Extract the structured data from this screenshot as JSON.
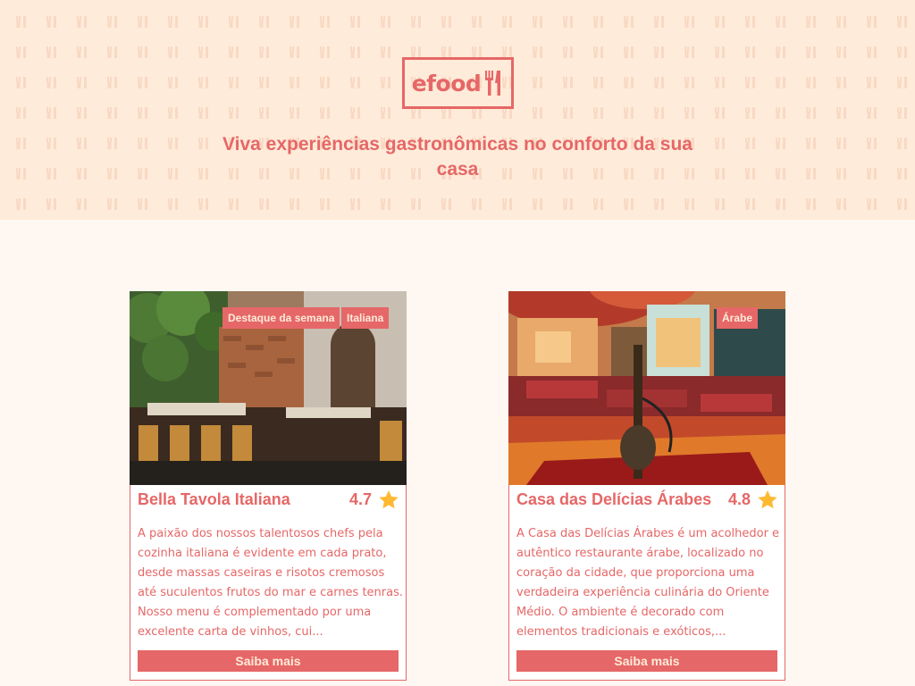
{
  "header": {
    "logo_text": "efood",
    "tagline": "Viva experiências gastronômicas no conforto da sua casa"
  },
  "colors": {
    "primary": "#E66767",
    "hero_bg": "#FFEBD9",
    "page_bg": "#FFF8F2",
    "star": "#FFB930"
  },
  "restaurants": [
    {
      "name": "Bella Tavola Italiana",
      "rating": "4.7",
      "tags": [
        "Destaque da semana",
        "Italiana"
      ],
      "description": "A paixão dos nossos talentosos chefs pela cozinha italiana é evidente em cada prato, desde massas caseiras e risotos cremosos até suculentos frutos do mar e carnes tenras. Nosso menu é complementado por uma excelente carta de vinhos, cui...",
      "button_label": "Saiba mais",
      "image_icon": "restaurant-photo"
    },
    {
      "name": "Casa das Delícias Árabes",
      "rating": "4.8",
      "tags": [
        "Árabe"
      ],
      "description": "A Casa das Delícias Árabes é um acolhedor e autêntico restaurante árabe, localizado no coração da cidade, que proporciona uma verdadeira experiência culinária do Oriente Médio. O ambiente é decorado com elementos tradicionais e exóticos,...",
      "button_label": "Saiba mais",
      "image_icon": "restaurant-photo"
    }
  ]
}
